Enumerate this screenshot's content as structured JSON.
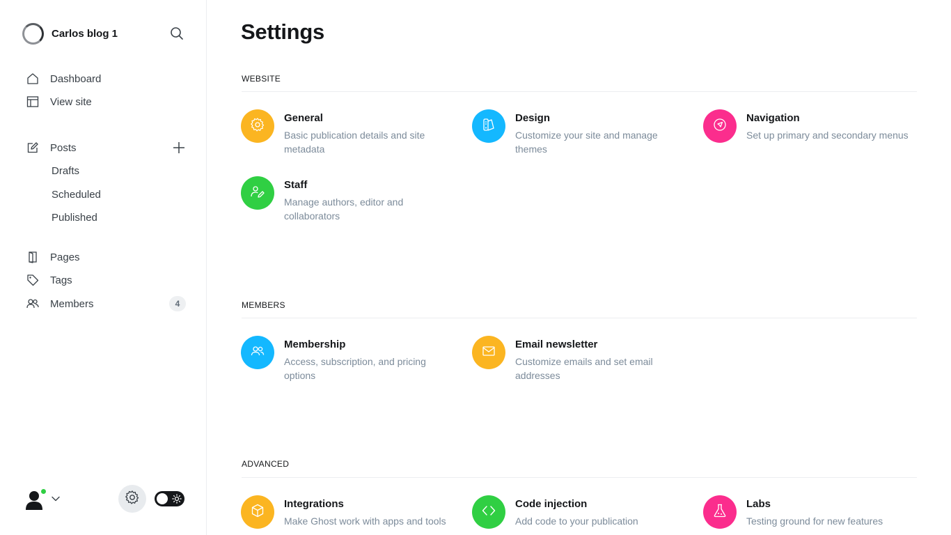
{
  "brand": {
    "name": "Carlos blog 1"
  },
  "nav": {
    "dashboard": "Dashboard",
    "view_site": "View site",
    "posts": "Posts",
    "drafts": "Drafts",
    "scheduled": "Scheduled",
    "published": "Published",
    "pages": "Pages",
    "tags": "Tags",
    "members": "Members",
    "members_count": "4"
  },
  "main": {
    "title": "Settings",
    "sections": {
      "website": {
        "heading": "WEBSITE",
        "general": {
          "title": "General",
          "desc": "Basic publication details and site metadata",
          "color": "#fbb521"
        },
        "design": {
          "title": "Design",
          "desc": "Customize your site and manage themes",
          "color": "#14b8ff"
        },
        "navigation": {
          "title": "Navigation",
          "desc": "Set up primary and secondary menus",
          "color": "#fb2d8d"
        },
        "staff": {
          "title": "Staff",
          "desc": "Manage authors, editor and collaborators",
          "color": "#30cf43"
        }
      },
      "members": {
        "heading": "MEMBERS",
        "membership": {
          "title": "Membership",
          "desc": "Access, subscription, and pricing options",
          "color": "#14b8ff"
        },
        "email_newsletter": {
          "title": "Email newsletter",
          "desc": "Customize emails and set email addresses",
          "color": "#fbb521"
        }
      },
      "advanced": {
        "heading": "ADVANCED",
        "integrations": {
          "title": "Integrations",
          "desc": "Make Ghost work with apps and tools",
          "color": "#fbb521"
        },
        "code_injection": {
          "title": "Code injection",
          "desc": "Add code to your publication",
          "color": "#30cf43"
        },
        "labs": {
          "title": "Labs",
          "desc": "Testing ground for new features",
          "color": "#fb2d8d"
        }
      }
    }
  },
  "icons": {
    "sidebar": [
      "home-icon",
      "view-site-icon",
      "edit-icon",
      "plus-icon",
      "pages-icon",
      "tag-icon",
      "members-icon",
      "search-icon"
    ],
    "cards": [
      "gear-icon",
      "brush-icon",
      "navigation-icon",
      "staff-icon",
      "membership-icon",
      "envelope-icon",
      "box-icon",
      "code-icon",
      "flask-icon"
    ]
  },
  "status": {
    "online": true,
    "dark_mode": true
  }
}
